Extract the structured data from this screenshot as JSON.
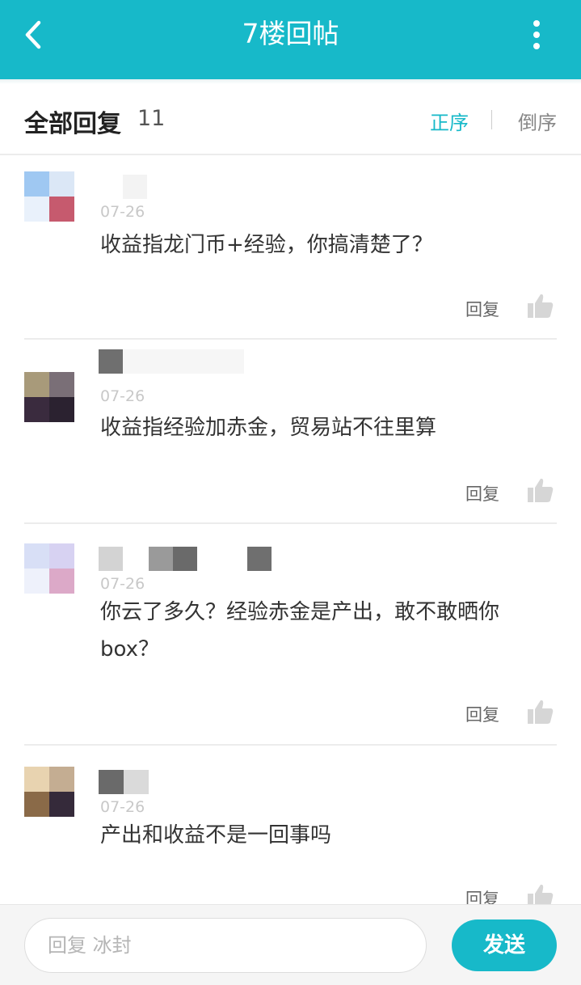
{
  "header": {
    "title": "7楼回帖",
    "back_icon": "back-chevron-icon",
    "more_icon": "more-vertical-icon",
    "background": "#17b9c9"
  },
  "sort_bar": {
    "heading": "全部回复",
    "count": "11",
    "ascending_label": "正序",
    "descending_label": "倒序",
    "active": "正序",
    "accent_color": "#17b9c9"
  },
  "replies": [
    {
      "date": "07-26",
      "content": "收益指龙门币+经验，你搞清楚了？",
      "reply_label": "回复",
      "like_icon": "thumbs-up-icon",
      "avatar_colors": [
        "#9fc8f2",
        "#dbe7f6",
        "#e9f1fb",
        "#c65a6e"
      ],
      "name_blocks": [
        "#ffffff",
        "#f3f3f3"
      ]
    },
    {
      "date": "07-26",
      "content": "收益指经验加赤金，贸易站不往里算",
      "reply_label": "回复",
      "like_icon": "thumbs-up-icon",
      "avatar_colors": [
        "#a89a7a",
        "#7a6f77",
        "#3a2b3e",
        "#2b2230"
      ],
      "name_blocks": [
        "#6f6f6f",
        "#f6f6f6"
      ]
    },
    {
      "date": "07-26",
      "content": "你云了多久？经验赤金是产出，敢不敢晒你box？",
      "reply_label": "回复",
      "like_icon": "thumbs-up-icon",
      "avatar_colors": [
        "#d8dff6",
        "#d7d2f2",
        "#eef1fb",
        "#dca9c8"
      ],
      "name_blocks": [
        "#d3d3d3",
        "#ffffff",
        "#9a9a9a",
        "#6a6a6a",
        "#ffffff",
        "#ffffff",
        "#6f6f6f"
      ]
    },
    {
      "date": "07-26",
      "content": "产出和收益不是一回事吗",
      "reply_label": "回复",
      "like_icon": "thumbs-up-icon",
      "avatar_colors": [
        "#e8d3b0",
        "#c4ad92",
        "#8a6a48",
        "#352a3a"
      ],
      "name_blocks": [
        "#6a6a6a",
        "#dadada"
      ]
    }
  ],
  "composer": {
    "placeholder": "回复 冰封",
    "send_label": "发送"
  }
}
